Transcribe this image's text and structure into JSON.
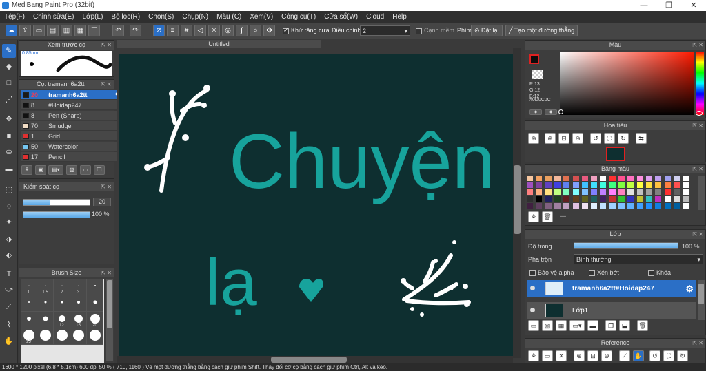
{
  "window": {
    "title": "MediBang Paint Pro (32bit)"
  },
  "menu": [
    "Tệp(F)",
    "Chỉnh sửa(E)",
    "Lớp(L)",
    "Bộ lọc(R)",
    "Chọn(S)",
    "Chụp(N)",
    "Màu (C)",
    "Xem(V)",
    "Công cụ(T)",
    "Cửa sổ(W)",
    "Cloud",
    "Help"
  ],
  "toolbar": {
    "antialias_label": "Khử răng cưa",
    "adjust_label": "Điều chỉnh",
    "adjust_value": "2",
    "edge_label": "Cạnh mềm",
    "key_label": "Phím",
    "reset_label": "Đặt lại",
    "line_label": "Tạo một đường thẳng"
  },
  "brush_preview": {
    "title": "Xem trước cọ",
    "size": "0.85mm"
  },
  "brush_list": {
    "title": "Cọ: tramanh6a2tt",
    "items": [
      {
        "size": "20",
        "name": "tramanh6a2tt",
        "color": "#1a1a1a"
      },
      {
        "size": "8",
        "name": "#Hoidap247",
        "color": "#111111"
      },
      {
        "size": "8",
        "name": "Pen (Sharp)",
        "color": "#111111"
      },
      {
        "size": "70",
        "name": "Smudge",
        "color": "#f1dcc4"
      },
      {
        "size": "1",
        "name": "Grid",
        "color": "#e03030"
      },
      {
        "size": "50",
        "name": "Watercolor",
        "color": "#74c5f0"
      },
      {
        "size": "17",
        "name": "Pencil",
        "color": "#e03030"
      }
    ]
  },
  "brush_control": {
    "title": "Kiểm soát cọ",
    "size_value": "20",
    "size_fraction": 0.4,
    "opacity_value": "100 %",
    "opacity_fraction": 1.0
  },
  "brush_size": {
    "title": "Brush Size",
    "labels": [
      "1",
      "1.5",
      "2",
      "3",
      "",
      "",
      "",
      "",
      "",
      "",
      "",
      "",
      "12",
      "15",
      "20",
      "25",
      "",
      "",
      "",
      ""
    ]
  },
  "document": {
    "tab": "Untitled",
    "text_main": "Chuyện",
    "text_second": "lạ",
    "text_color": "#17a39c",
    "background": "#0e2f30"
  },
  "status": {
    "text": "1600 * 1200 pixel   (6.8 * 5.1cm)   600 dpi   50 %   ( 710, 1160 )   Vẽ một đường thẳng bằng cách giữ phím Shift. Thay đổi cỡ cọ bằng cách giữ phím Ctrl, Alt và kéo."
  },
  "color_panel": {
    "title": "Màu",
    "r": "R:13",
    "g": "G:12",
    "b": "B:12",
    "hex": "#0D0C0C"
  },
  "navigator": {
    "title": "Hoa tiêu"
  },
  "palette": {
    "title": "Bảng màu",
    "empty_label": "---",
    "colors": [
      "#f7c7a0",
      "#f4a261",
      "#e9a060",
      "#f2b89c",
      "#e07050",
      "#d45050",
      "#e85a80",
      "#f0a0c0",
      "#ffffff",
      "#ff3030",
      "#ff5090",
      "#ff70c0",
      "#ff90e0",
      "#e0a0f0",
      "#c0a0f0",
      "#a0a0f0",
      "#d0d0f0",
      "#ffffff",
      "#a050c0",
      "#8040a0",
      "#6040c0",
      "#4040e0",
      "#6080f0",
      "#80a0ff",
      "#40c0ff",
      "#40e0ff",
      "#40ffe0",
      "#40ff80",
      "#80ff40",
      "#c0ff40",
      "#ffff40",
      "#ffe040",
      "#ffc040",
      "#ff8040",
      "#ff5050",
      "#ffffff",
      "#ff8080",
      "#ffb080",
      "#ffe080",
      "#c0ff80",
      "#80ffc0",
      "#80ffff",
      "#80c0ff",
      "#8080ff",
      "#c080ff",
      "#ff80ff",
      "#ff80c0",
      "#e0e0e0",
      "#c0c0c0",
      "#a0a0a0",
      "#808080",
      "#ff3030",
      "#606060",
      "#ffffff",
      "#303030",
      "#000000",
      "#202060",
      "#204020",
      "#602020",
      "#604020",
      "#606020",
      "#206060",
      "#402060",
      "#c03030",
      "#30c030",
      "#3030c0",
      "#c0c030",
      "#30c0c0",
      "#c030c0",
      "#ffffff",
      "#dddddd",
      "#bbbbbb",
      "#402040",
      "#604060",
      "#806080",
      "#a080a0",
      "#c0a0c0",
      "#e0c0e0",
      "#f0e0f0",
      "#e0f0ff",
      "#c0e0ff",
      "#a0d0ff",
      "#80c0ff",
      "#60b0ff",
      "#40a0ff",
      "#2090ff",
      "#1080e0",
      "#0070c0",
      "#0060a0",
      "#ffffff"
    ]
  },
  "layers": {
    "title": "Lớp",
    "opacity_label": "Độ trong",
    "opacity_value": "100 %",
    "opacity_fraction": 1.0,
    "blend_label": "Pha trộn",
    "blend_value": "Bình thường",
    "protect_alpha": "Bảo vệ alpha",
    "clipping": "Xén bớt",
    "lock": "Khóa",
    "items": [
      {
        "name": "tramanh6a2tt#Hoidap247",
        "selected": true
      },
      {
        "name": "Lớp1",
        "selected": false
      }
    ]
  },
  "reference": {
    "title": "Reference"
  }
}
